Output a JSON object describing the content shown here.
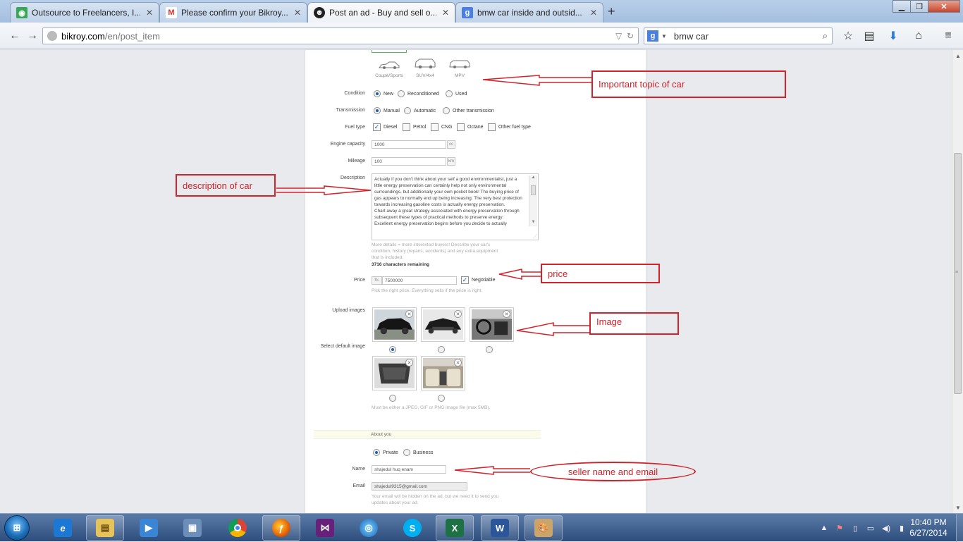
{
  "browser": {
    "tabs": [
      {
        "label": "Outsource to Freelancers, I...",
        "icon": "freelancer-icon",
        "active": false
      },
      {
        "label": "Please confirm your Bikroy...",
        "icon": "gmail-icon",
        "active": false
      },
      {
        "label": "Post an ad - Buy and sell o...",
        "icon": "bikroy-icon",
        "active": true
      },
      {
        "label": "bmw car inside and outsid...",
        "icon": "google-icon",
        "active": false
      }
    ],
    "url_host": "bikroy.com",
    "url_path": "/en/post_item",
    "search_value": "bmw car"
  },
  "form": {
    "car_types": [
      "Coupé/Sports",
      "SUV/4x4",
      "MPV"
    ],
    "condition": {
      "label": "Condition",
      "options": [
        "New",
        "Reconditioned",
        "Used"
      ],
      "selected": "New"
    },
    "transmission": {
      "label": "Transmission",
      "options": [
        "Manual",
        "Automatic",
        "Other transmission"
      ],
      "selected": "Manual"
    },
    "fuel": {
      "label": "Fuel type",
      "options": [
        "Diesel",
        "Petrol",
        "CNG",
        "Octane",
        "Other fuel type"
      ],
      "checked": [
        "Diesel"
      ]
    },
    "engine": {
      "label": "Engine capacity",
      "value": "1000",
      "unit": "cc"
    },
    "mileage": {
      "label": "Mileage",
      "value": "100",
      "unit": "km"
    },
    "description": {
      "label": "Description",
      "text": "Actually if you don't think about your self a good environmentalist, just a little energy preservation can certainly help not only environmental surroundings, but additionally your own pocket book! The buying price of gas appears to normally end up being increasing. The very best protection towards increasing gasoline costs is actually energy preservation.\nChart away a great strategy associated with energy preservation through subsequent these types of practical methods to preserve energy:\nExcellent energy preservation begins before you decide to actually",
      "hint": "More details = more interested buyers! Describe your car's condition, history (repairs, accidents) and any extra equipment that is included.",
      "remaining": "3716 characters remaining"
    },
    "price": {
      "label": "Price",
      "currency": "Tk.",
      "value": "7500000",
      "negotiable_label": "Negotiable",
      "negotiable": true,
      "hint": "Pick the right price. Everything sells if the price is right."
    },
    "images": {
      "label": "Upload images",
      "default_label": "Select default image",
      "count": 5,
      "default_index": 0,
      "hint": "Must be either a JPEG, GIF or PNG image file (max 5MB)."
    },
    "about": {
      "section": "About you",
      "account_types": [
        "Private",
        "Business"
      ],
      "account_selected": "Private",
      "name_label": "Name",
      "name_value": "shajedul huq enam",
      "email_label": "Email",
      "email_value": "shajedul9315@gmail.com",
      "email_hint": "Your email will be hidden on the ad, but we need it to send you updates about your ad."
    }
  },
  "annotations": {
    "topic": "Important topic of car",
    "description": "description  of car",
    "price": "price",
    "image": "Image",
    "seller": "seller name and email"
  },
  "taskbar": {
    "apps": [
      "explorer",
      "internet-explorer",
      "file-manager",
      "media-player",
      "remote-desktop",
      "chrome",
      "firefox",
      "visual-studio",
      "network-app",
      "skype",
      "excel",
      "word",
      "paint"
    ],
    "time": "10:40 PM",
    "date": "6/27/2014"
  },
  "colors": {
    "annotation": "#d4222a",
    "accent": "#1f5fa8",
    "taskbar": "#2d4e7d"
  }
}
